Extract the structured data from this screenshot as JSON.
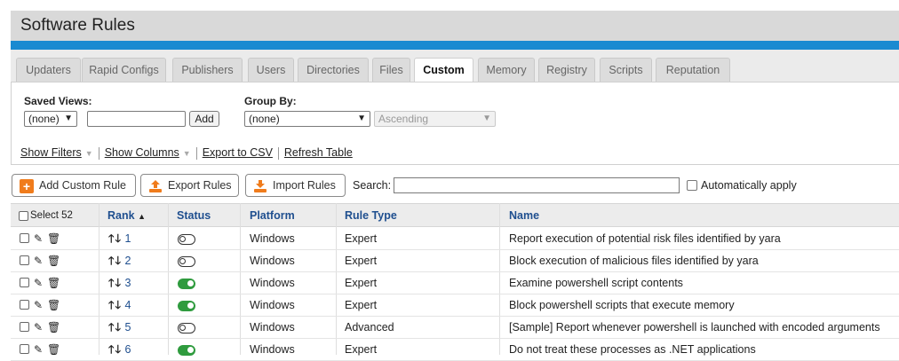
{
  "page": {
    "title": "Software Rules",
    "accent_color": "#1a8ad1"
  },
  "tabs": [
    {
      "label": "Updaters",
      "active": false
    },
    {
      "label": "Rapid Configs",
      "active": false
    },
    {
      "label": "Publishers",
      "active": false
    },
    {
      "label": "Users",
      "active": false
    },
    {
      "label": "Directories",
      "active": false
    },
    {
      "label": "Files",
      "active": false
    },
    {
      "label": "Custom",
      "active": true
    },
    {
      "label": "Memory",
      "active": false
    },
    {
      "label": "Registry",
      "active": false
    },
    {
      "label": "Scripts",
      "active": false
    },
    {
      "label": "Reputation",
      "active": false
    }
  ],
  "filters": {
    "saved_views_label": "Saved Views:",
    "saved_views_value": "(none)",
    "view_name_value": "",
    "add_label": "Add",
    "group_by_label": "Group By:",
    "group_by_value": "(none)",
    "order_value": "Ascending"
  },
  "links": {
    "show_filters": "Show Filters",
    "show_columns": "Show Columns",
    "export_csv": "Export to CSV",
    "refresh_table": "Refresh Table"
  },
  "toolbar": {
    "add_custom_rule": "Add Custom Rule",
    "export_rules": "Export Rules",
    "import_rules": "Import Rules",
    "search_label": "Search:",
    "search_value": "",
    "auto_apply_label": "Automatically apply",
    "icon_color": "#f07c1c"
  },
  "table": {
    "select_label": "Select 52",
    "headers": {
      "rank": "Rank",
      "status": "Status",
      "platform": "Platform",
      "rule_type": "Rule Type",
      "name": "Name"
    },
    "sort_indicator": "▲",
    "rows": [
      {
        "rank": "1",
        "status_on": false,
        "platform": "Windows",
        "rule_type": "Expert",
        "name": "Report execution of potential risk files identified by yara"
      },
      {
        "rank": "2",
        "status_on": false,
        "platform": "Windows",
        "rule_type": "Expert",
        "name": "Block execution of malicious files identified by yara"
      },
      {
        "rank": "3",
        "status_on": true,
        "platform": "Windows",
        "rule_type": "Expert",
        "name": "Examine powershell script contents"
      },
      {
        "rank": "4",
        "status_on": true,
        "platform": "Windows",
        "rule_type": "Expert",
        "name": "Block powershell scripts that execute memory"
      },
      {
        "rank": "5",
        "status_on": false,
        "platform": "Windows",
        "rule_type": "Advanced",
        "name": "[Sample] Report whenever powershell is launched with encoded arguments"
      },
      {
        "rank": "6",
        "status_on": true,
        "platform": "Windows",
        "rule_type": "Expert",
        "name": "Do not treat these processes as .NET applications"
      }
    ]
  }
}
